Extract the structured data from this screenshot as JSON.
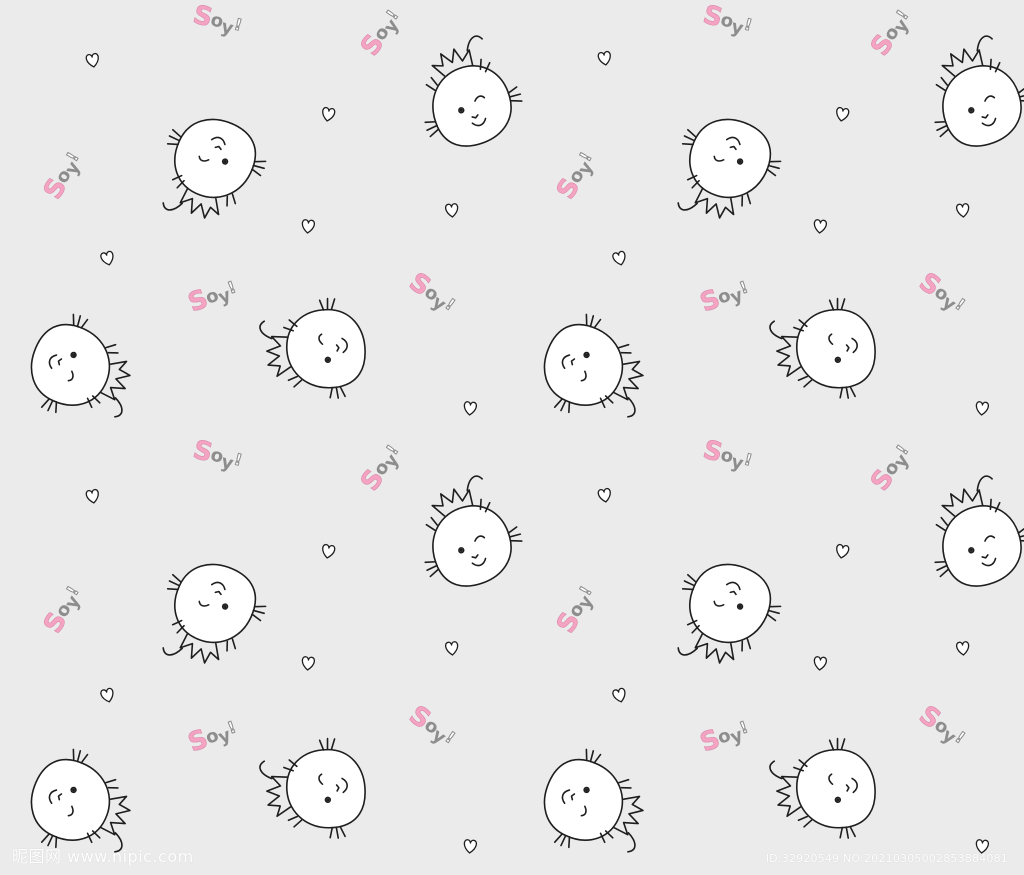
{
  "pattern": {
    "background": "#ebebeb",
    "line_color": "#1e1e1e",
    "pink": "#f4a3c2",
    "grey": "#8d8d8d",
    "motifs": [
      "cat-icon",
      "heart-icon",
      "soy-lettering"
    ],
    "lettering": "Soy!"
  },
  "watermark": {
    "site": "昵图网 www.nipic.com",
    "id": "ID:32920549 NO:20210305002853884081"
  }
}
